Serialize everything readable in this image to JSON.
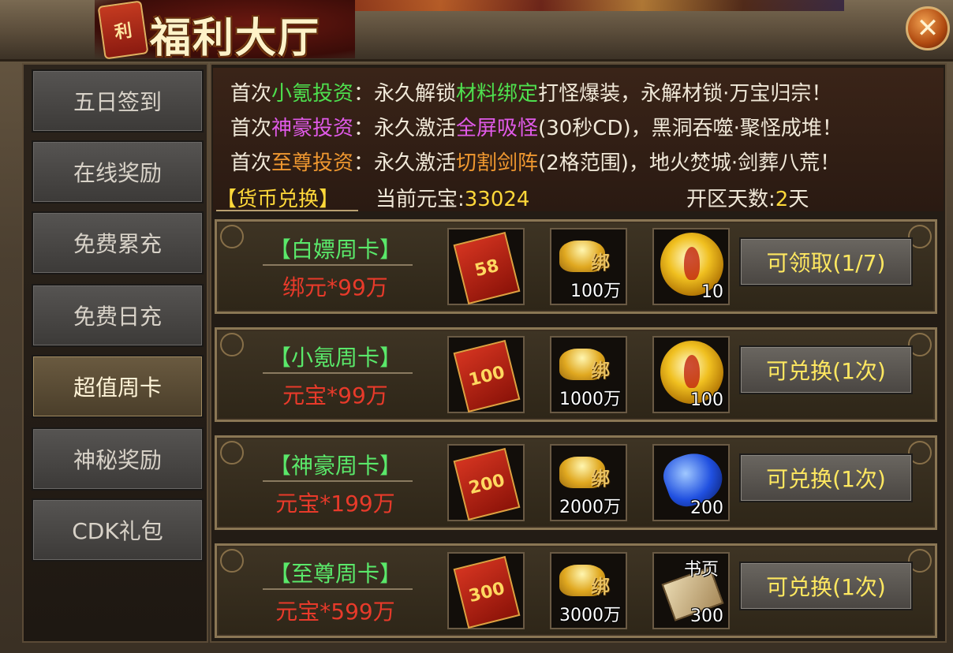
{
  "header": {
    "seal_text": "利",
    "title": "福利大厅",
    "close_glyph": "✕"
  },
  "nav": {
    "items": [
      {
        "label": "五日签到",
        "active": false
      },
      {
        "label": "在线奖励",
        "active": false
      },
      {
        "label": "免费累充",
        "active": false
      },
      {
        "label": "免费日充",
        "active": false
      },
      {
        "label": "超值周卡",
        "active": true
      },
      {
        "label": "神秘奖励",
        "active": false
      },
      {
        "label": "CDK礼包",
        "active": false
      }
    ]
  },
  "info": {
    "line1": {
      "prefix": "首次",
      "highlight": "小氪投资",
      "mid": "：永久解锁",
      "feature": "材料绑定",
      "suffix": "打怪爆装，永解材锁·万宝归宗！"
    },
    "line2": {
      "prefix": "首次",
      "highlight": "神豪投资",
      "mid": "：永久激活",
      "feature": "全屏吸怪",
      "suffix": "(30秒CD)，黑洞吞噬·聚怪成堆！"
    },
    "line3": {
      "prefix": "首次",
      "highlight": "至尊投资",
      "mid": "：永久激活",
      "feature": "切割剑阵",
      "suffix": "(2格范围)，地火焚城·剑葬八荒！"
    },
    "currency_link": "【货币兑换】",
    "ingot_label": "当前元宝:",
    "ingot_value": "33024",
    "server_days_label": "开区天数:",
    "server_days_value": "2",
    "server_days_unit": "天"
  },
  "cards": [
    {
      "name": "【白嫖周卡】",
      "price": "绑元*99万",
      "envelope": "58",
      "ingot_tag": "绑",
      "ingot_qty": "100万",
      "reward_icon": "gold-orb-icon",
      "reward_qty": "10",
      "reward_tag": "",
      "button": "可领取(1/7)"
    },
    {
      "name": "【小氪周卡】",
      "price": "元宝*99万",
      "envelope": "100",
      "ingot_tag": "绑",
      "ingot_qty": "1000万",
      "reward_icon": "gold-orb-icon",
      "reward_qty": "100",
      "reward_tag": "",
      "button": "可兑换(1次)"
    },
    {
      "name": "【神豪周卡】",
      "price": "元宝*199万",
      "envelope": "200",
      "ingot_tag": "绑",
      "ingot_qty": "2000万",
      "reward_icon": "blue-crystal-icon",
      "reward_qty": "200",
      "reward_tag": "",
      "button": "可兑换(1次)"
    },
    {
      "name": "【至尊周卡】",
      "price": "元宝*599万",
      "envelope": "300",
      "ingot_tag": "绑",
      "ingot_qty": "3000万",
      "reward_icon": "scroll-page-icon",
      "reward_qty": "300",
      "reward_tag": "书页",
      "button": "可兑换(1次)"
    }
  ]
}
